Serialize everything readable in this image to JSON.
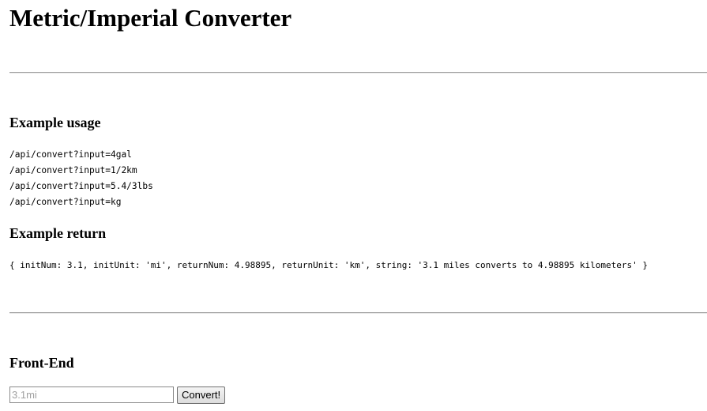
{
  "page_title": "Metric/Imperial Converter",
  "sections": {
    "usage": {
      "heading": "Example usage",
      "lines": [
        "/api/convert?input=4gal",
        "/api/convert?input=1/2km",
        "/api/convert?input=5.4/3lbs",
        "/api/convert?input=kg"
      ]
    },
    "return": {
      "heading": "Example return",
      "code": "{ initNum: 3.1, initUnit: 'mi', returnNum: 4.98895, returnUnit: 'km', string: '3.1 miles converts to 4.98895 kilometers' }"
    },
    "frontend": {
      "heading": "Front-End",
      "input_value": "",
      "input_placeholder": "3.1mi",
      "button_label": "Convert!"
    }
  }
}
